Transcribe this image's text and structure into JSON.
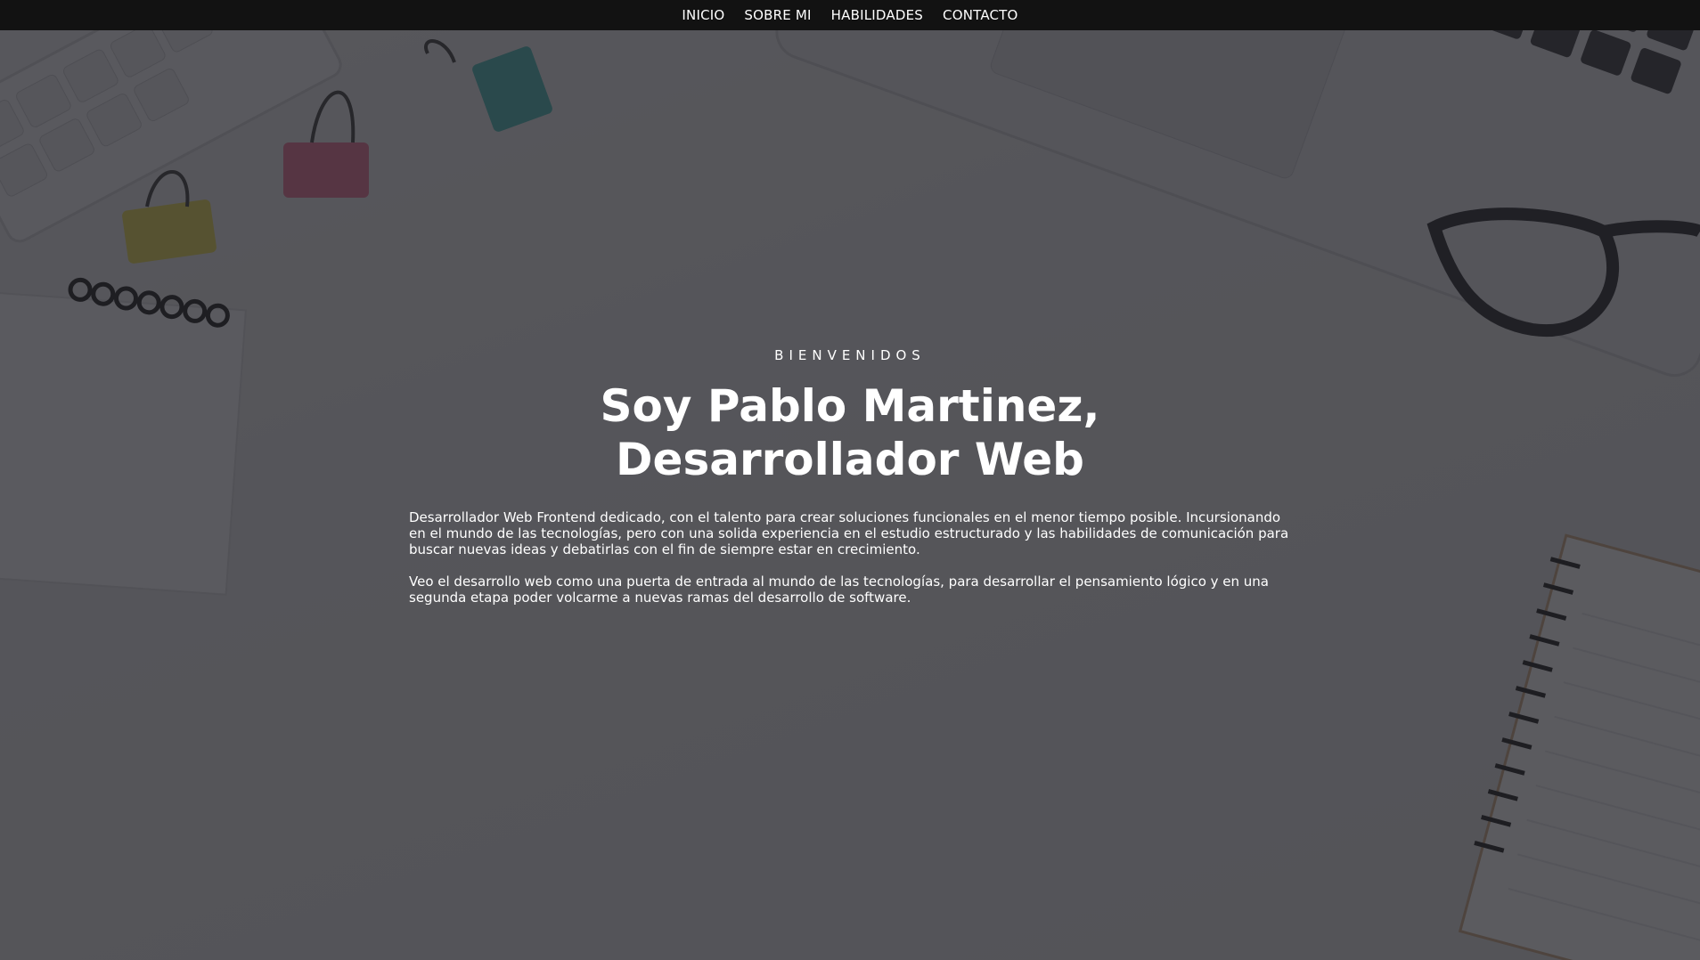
{
  "nav": {
    "items": [
      {
        "label": "INICIO"
      },
      {
        "label": "SOBRE MI"
      },
      {
        "label": "HABILIDADES"
      },
      {
        "label": "CONTACTO"
      }
    ]
  },
  "hero": {
    "kicker": "BIENVENIDOS",
    "title": "Soy Pablo Martinez, Desarrollador Web",
    "paragraphs": [
      "Desarrollador Web Frontend dedicado, con el talento para crear soluciones funcionales en el menor tiempo posible. Incursionando en el mundo de las tecnologías, pero con una solida experiencia en el estudio estructurado y las habilidades de comunicación para buscar nuevas ideas y debatirlas con el fin de siempre estar en crecimiento.",
      "Veo el desarrollo web como una puerta de entrada al mundo de las tecnologías, para desarrollar el pensamiento lógico y en una segunda etapa poder volcarme a nuevas ramas del desarrollo de software."
    ]
  },
  "colors": {
    "navbar": "#121212",
    "overlay": "#232328",
    "text": "#ffffff"
  }
}
